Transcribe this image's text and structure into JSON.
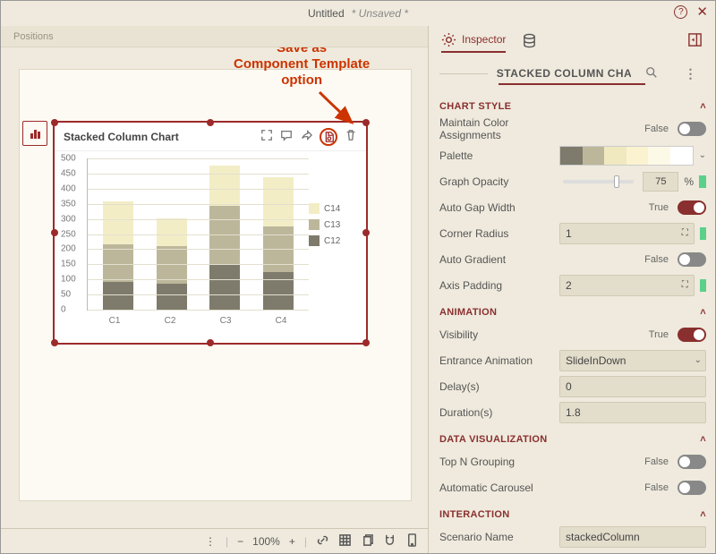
{
  "titlebar": {
    "title": "Untitled",
    "status": "* Unsaved *"
  },
  "canvas_tab": "Positions",
  "chart_card": {
    "title": "Stacked Column Chart"
  },
  "annotation": {
    "line1": "Save as",
    "line2": "Component Template",
    "line3": "option"
  },
  "chart_data": {
    "type": "bar-stacked",
    "title": "Stacked Column Chart",
    "ylabel": "",
    "xlabel": "",
    "ylim": [
      0,
      500
    ],
    "yticks": [
      0,
      50,
      100,
      150,
      200,
      250,
      300,
      350,
      400,
      450,
      500
    ],
    "categories": [
      "C1",
      "C2",
      "C3",
      "C4"
    ],
    "series": [
      {
        "name": "C12",
        "color": "#7e7b6c",
        "values": [
          90,
          85,
          150,
          125
        ]
      },
      {
        "name": "C13",
        "color": "#bcb79a",
        "values": [
          125,
          125,
          190,
          150
        ]
      },
      {
        "name": "C14",
        "color": "#f3edc6",
        "values": [
          140,
          90,
          135,
          160
        ]
      }
    ]
  },
  "legend_order": [
    "C14",
    "C13",
    "C12"
  ],
  "bottombar": {
    "zoom": "100%"
  },
  "inspector": {
    "tabs": {
      "inspector": "Inspector"
    },
    "header": "STACKED COLUMN CHART",
    "sections": {
      "chart_style": {
        "title": "CHART STYLE",
        "maintain_color_assignments": {
          "label": "Maintain Color\nAssignments",
          "value": "False"
        },
        "palette_label": "Palette",
        "palette_colors": [
          "#7e7b6c",
          "#bcb79a",
          "#f0e9c0",
          "#fbf3cf",
          "#fdf9e7",
          "#ffffff"
        ],
        "graph_opacity": {
          "label": "Graph Opacity",
          "value": "75",
          "unit": "%"
        },
        "auto_gap_width": {
          "label": "Auto Gap Width",
          "value": "True"
        },
        "corner_radius": {
          "label": "Corner Radius",
          "value": "1"
        },
        "auto_gradient": {
          "label": "Auto Gradient",
          "value": "False"
        },
        "axis_padding": {
          "label": "Axis Padding",
          "value": "2"
        }
      },
      "animation": {
        "title": "ANIMATION",
        "visibility": {
          "label": "Visibility",
          "value": "True"
        },
        "entrance": {
          "label": "Entrance Animation",
          "value": "SlideInDown"
        },
        "delay": {
          "label": "Delay(s)",
          "value": "0"
        },
        "duration": {
          "label": "Duration(s)",
          "value": "1.8"
        }
      },
      "data_viz": {
        "title": "DATA VISUALIZATION",
        "top_n": {
          "label": "Top N Grouping",
          "value": "False"
        },
        "carousel": {
          "label": "Automatic Carousel",
          "value": "False"
        }
      },
      "interaction": {
        "title": "INTERACTION",
        "scenario": {
          "label": "Scenario Name",
          "value": "stackedColumn"
        }
      }
    }
  }
}
